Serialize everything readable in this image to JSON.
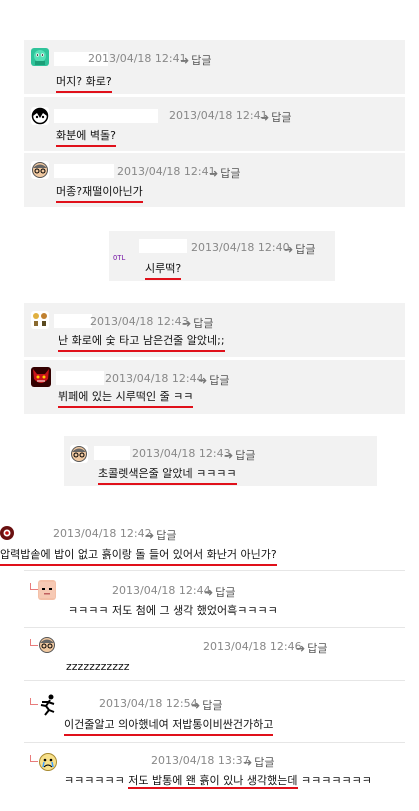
{
  "reply_label": "답글",
  "comments": [
    {
      "date": "2013/04/18 12:41",
      "text": "머지? 화로?",
      "avatar": "green-monster-avatar-icon"
    },
    {
      "date": "2013/04/18 12:41",
      "text": "화분에 벽돌?",
      "avatar": "black-face-avatar-icon"
    },
    {
      "date": "2013/04/18 12:41",
      "text": "머종?재떨이아닌가",
      "avatar": "glasses-man-avatar-icon"
    },
    {
      "date": "2013/04/18 12:40",
      "text": "시루떡?",
      "avatar": "otl-avatar-icon",
      "avatar_text": "OTL"
    },
    {
      "date": "2013/04/18 12:43",
      "text": "난 화로에 숯 타고 남은건줄 알았네;;",
      "avatar": "small-figures-avatar-icon"
    },
    {
      "date": "2013/04/18 12:44",
      "text": "뷔페에 있는 시루떡인 줄 ㅋㅋ",
      "avatar": "red-devil-avatar-icon"
    },
    {
      "date": "2013/04/18 12:43",
      "text": "초콜렛색은줄 알았네 ㅋㅋㅋㅋ",
      "avatar": "glasses-man-avatar-icon"
    },
    {
      "date": "2013/04/18 12:42",
      "text": "압력밥솥에 밥이 없고 흙이랑 돌 들어 있어서 화난거 아닌가?",
      "avatar": "red-eye-avatar-icon"
    },
    {
      "date": "2013/04/18 12:44",
      "text": "ㅋㅋㅋㅋ 저도 첨에 그 생각 했었어흑ㅋㅋㅋㅋ",
      "avatar": "pink-face-avatar-icon"
    },
    {
      "date": "2013/04/18 12:46",
      "text": "zzzzzzzzzzz",
      "avatar": "glasses-man-avatar-icon"
    },
    {
      "date": "2013/04/18 12:54",
      "text": "이건줄알고 의아했네여 저밥통이비싼건가하고",
      "avatar": "running-man-avatar-icon"
    },
    {
      "date": "2013/04/18 13:37",
      "text_pre": "ㅋㅋㅋㅋㅋㅋ ",
      "text_mid": "저도 밥통에 왠 흙이 있나 생각했는데",
      "text_post": " ㅋㅋㅋㅋㅋㅋㅋ",
      "avatar": "crying-face-avatar-icon"
    }
  ]
}
